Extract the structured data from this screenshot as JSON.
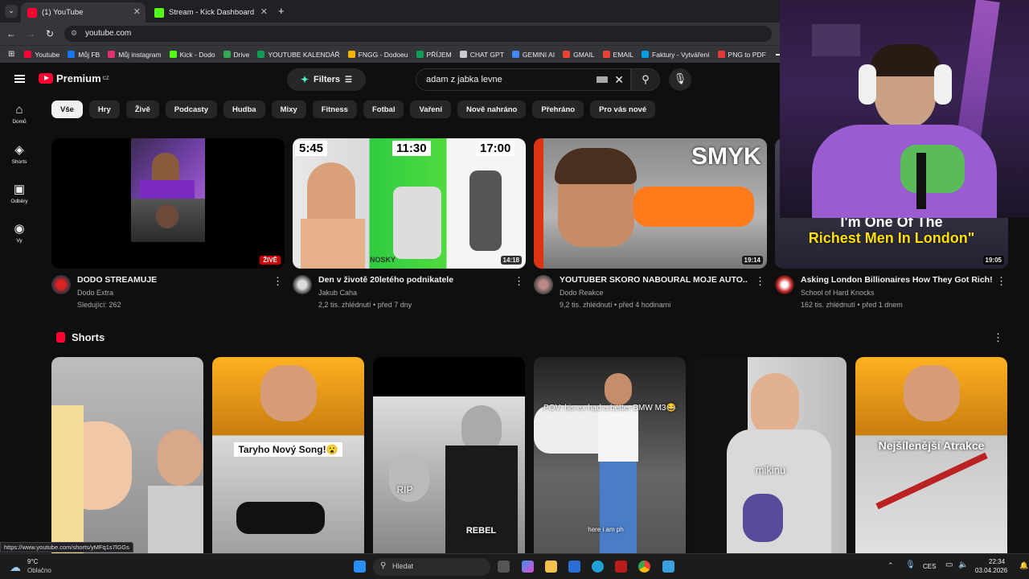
{
  "browser": {
    "tabs": [
      {
        "title": "(1) YouTube",
        "color": "#ff0033"
      },
      {
        "title": "Stream - Kick Dashboard",
        "color": "#53fc18"
      }
    ],
    "url": "youtube.com",
    "status_url": "https://www.youtube.com/shorts/yMFq1s7lGGs",
    "bookmarks": [
      {
        "label": "Youtube",
        "color": "#ff0033"
      },
      {
        "label": "Můj FB",
        "color": "#1877f2"
      },
      {
        "label": "Můj instagram",
        "color": "#e1306c"
      },
      {
        "label": "Kick - Dodo",
        "color": "#53fc18"
      },
      {
        "label": "Drive",
        "color": "#34a853"
      },
      {
        "label": "YOUTUBE KALENDÁŘ",
        "color": "#0f9d58"
      },
      {
        "label": "FNGG - Dodoeu",
        "color": "#f4b400"
      },
      {
        "label": "PŘÍJEM",
        "color": "#0f9d58"
      },
      {
        "label": "CHAT GPT",
        "color": "#cccccc"
      },
      {
        "label": "GEMINI AI",
        "color": "#4285f4"
      },
      {
        "label": "GMAIL",
        "color": "#ea4335"
      },
      {
        "label": "EMAIL",
        "color": "#ea4335"
      },
      {
        "label": "Faktury - Vytváření",
        "color": "#00a0e3"
      },
      {
        "label": "PNG to PDF",
        "color": "#e53935"
      }
    ]
  },
  "youtube": {
    "logo_text": "Premium",
    "logo_country": "CZ",
    "filters_label": "Filters",
    "search_value": "adam z jabka levne",
    "sidebar": [
      {
        "icon": "home-icon",
        "glyph": "⌂",
        "label": "Domů"
      },
      {
        "icon": "shorts-icon",
        "glyph": "◈",
        "label": "Shorts"
      },
      {
        "icon": "subscriptions-icon",
        "glyph": "▣",
        "label": "Odběry"
      },
      {
        "icon": "user-icon",
        "glyph": "◉",
        "label": "Vy"
      }
    ],
    "chips": [
      "Vše",
      "Hry",
      "Živě",
      "Podcasty",
      "Hudba",
      "Mixy",
      "Fitness",
      "Fotbal",
      "Vaření",
      "Nově nahráno",
      "Přehráno",
      "Pro vás nové"
    ],
    "videos": [
      {
        "title": "DODO STREAMUJE",
        "channel": "Dodo Extra",
        "stats": "Sledující: 262",
        "badge": "ŽIVĚ",
        "is_live": true
      },
      {
        "title": "Den v životě 20letého podnikatele",
        "channel": "Jakub Caha",
        "stats": "2,2 tis. zhlédnutí • před 7 dny",
        "badge": "14:18",
        "is_live": false,
        "thumb_text": [
          "5:45",
          "11:30",
          "17:00"
        ],
        "thumb_sub": "NOSKY"
      },
      {
        "title": "YOUTUBER SKORO NABOURAL MOJE AUTO..",
        "channel": "Dodo Reakce",
        "stats": "9,2 tis. zhlédnutí • před 4 hodinami",
        "badge": "19:14",
        "is_live": false,
        "thumb_text": "SMYK"
      },
      {
        "title": "Asking London Billionaires How They Got Rich!",
        "channel": "School of Hard Knocks",
        "stats": "162 tis. zhlédnutí • před 1 dnem",
        "badge": "19:05",
        "is_live": false,
        "thumb_text": [
          "I'm One Of The",
          "Richest Men In London\""
        ]
      }
    ],
    "shorts_title": "Shorts",
    "shorts": [
      {
        "caption": ""
      },
      {
        "caption": "Taryho Nový Song!😮"
      },
      {
        "caption": "RIP",
        "sub": "REBEL"
      },
      {
        "caption": "POV: his ex had a better BMW M3😂",
        "bottom": "here i am ph"
      },
      {
        "caption": "mikinu"
      },
      {
        "caption": "Nejšílenější Atrakce"
      }
    ]
  },
  "taskbar": {
    "weather_temp": "9°C",
    "weather_desc": "Oblačno",
    "search_placeholder": "Hledat",
    "lang": "CES",
    "time": "22:34",
    "date": "03.04.2026"
  }
}
